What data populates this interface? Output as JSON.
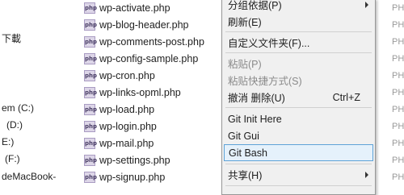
{
  "nav": {
    "items": [
      {
        "label": "下載"
      },
      {
        "label": "em (C:)"
      },
      {
        "label": "(D:)"
      },
      {
        "label": "E:)"
      },
      {
        "label": "(F:)"
      },
      {
        "label": "deMacBook-"
      }
    ]
  },
  "files": [
    {
      "icon": "php",
      "name": "wp-activate.php"
    },
    {
      "icon": "php",
      "name": "wp-blog-header.php"
    },
    {
      "icon": "php",
      "name": "wp-comments-post.php"
    },
    {
      "icon": "php",
      "name": "wp-config-sample.php"
    },
    {
      "icon": "php",
      "name": "wp-cron.php"
    },
    {
      "icon": "php",
      "name": "wp-links-opml.php"
    },
    {
      "icon": "php",
      "name": "wp-load.php"
    },
    {
      "icon": "php",
      "name": "wp-login.php"
    },
    {
      "icon": "php",
      "name": "wp-mail.php"
    },
    {
      "icon": "php",
      "name": "wp-settings.php"
    },
    {
      "icon": "php",
      "name": "wp-signup.php"
    }
  ],
  "type_column": [
    "PH",
    "PH",
    "PH",
    "PH",
    "PH",
    "PH",
    "PH",
    "PH",
    "PH",
    "PH",
    "PH"
  ],
  "context_menu": {
    "items": [
      {
        "label": "分组依据(P)",
        "submenu": true
      },
      {
        "label": "刷新(E)"
      },
      {
        "label": "自定义文件夹(F)..."
      },
      {
        "label": "粘贴(P)",
        "disabled": true
      },
      {
        "label": "粘贴快捷方式(S)",
        "disabled": true
      },
      {
        "label": "撤消 删除(U)",
        "shortcut": "Ctrl+Z"
      },
      {
        "label": "Git Init Here"
      },
      {
        "label": "Git Gui"
      },
      {
        "label": "Git Bash",
        "highlighted": true
      },
      {
        "label": "共享(H)",
        "submenu": true
      }
    ]
  }
}
